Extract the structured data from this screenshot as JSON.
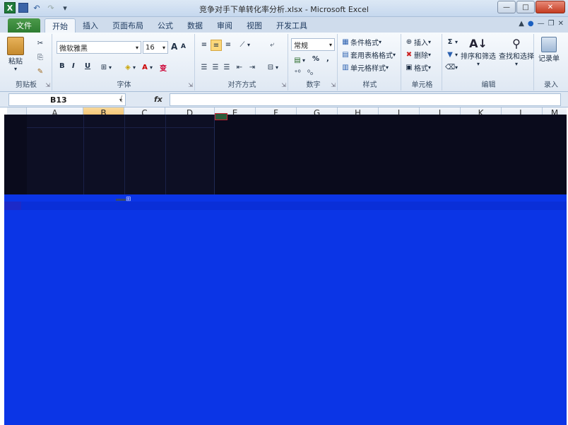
{
  "window": {
    "title": "竞争对手下单转化率分析.xlsx - Microsoft Excel",
    "minimize": "—",
    "maximize": "□",
    "close": "✕"
  },
  "qat": {
    "logo": "X",
    "undo": "↶",
    "redo": "↷",
    "customize": "▾"
  },
  "tabs": [
    "文件",
    "开始",
    "插入",
    "页面布局",
    "公式",
    "数据",
    "审阅",
    "视图",
    "开发工具"
  ],
  "ribbon": {
    "clipboard": {
      "label": "剪贴板",
      "paste": "粘贴"
    },
    "font": {
      "label": "字体",
      "family": "微软雅黑",
      "size": "16",
      "bold": "B",
      "italic": "I",
      "underline": "U",
      "grow": "A",
      "shrink": "A",
      "wen": "变"
    },
    "alignment": {
      "label": "对齐方式"
    },
    "number": {
      "label": "数字",
      "format": "常规",
      "percent": "%",
      "comma": ","
    },
    "styles": {
      "label": "样式",
      "conditional": "条件格式",
      "as_table": "套用表格格式",
      "cell_styles": "单元格样式"
    },
    "cells": {
      "label": "单元格",
      "insert": "插入",
      "delete": "删除",
      "format": "格式"
    },
    "editing": {
      "label": "编辑",
      "sort": "排序和筛选",
      "find": "查找和选择"
    },
    "record": {
      "label": "录入",
      "record_btn": "记录单"
    }
  },
  "formula_bar": {
    "name_box": "B13",
    "fx": "fx",
    "value": ""
  },
  "columns": [
    "A",
    "B",
    "C",
    "D",
    "E",
    "F",
    "G",
    "H",
    "I",
    "J",
    "K",
    "L",
    "M"
  ],
  "selected_column": "B"
}
